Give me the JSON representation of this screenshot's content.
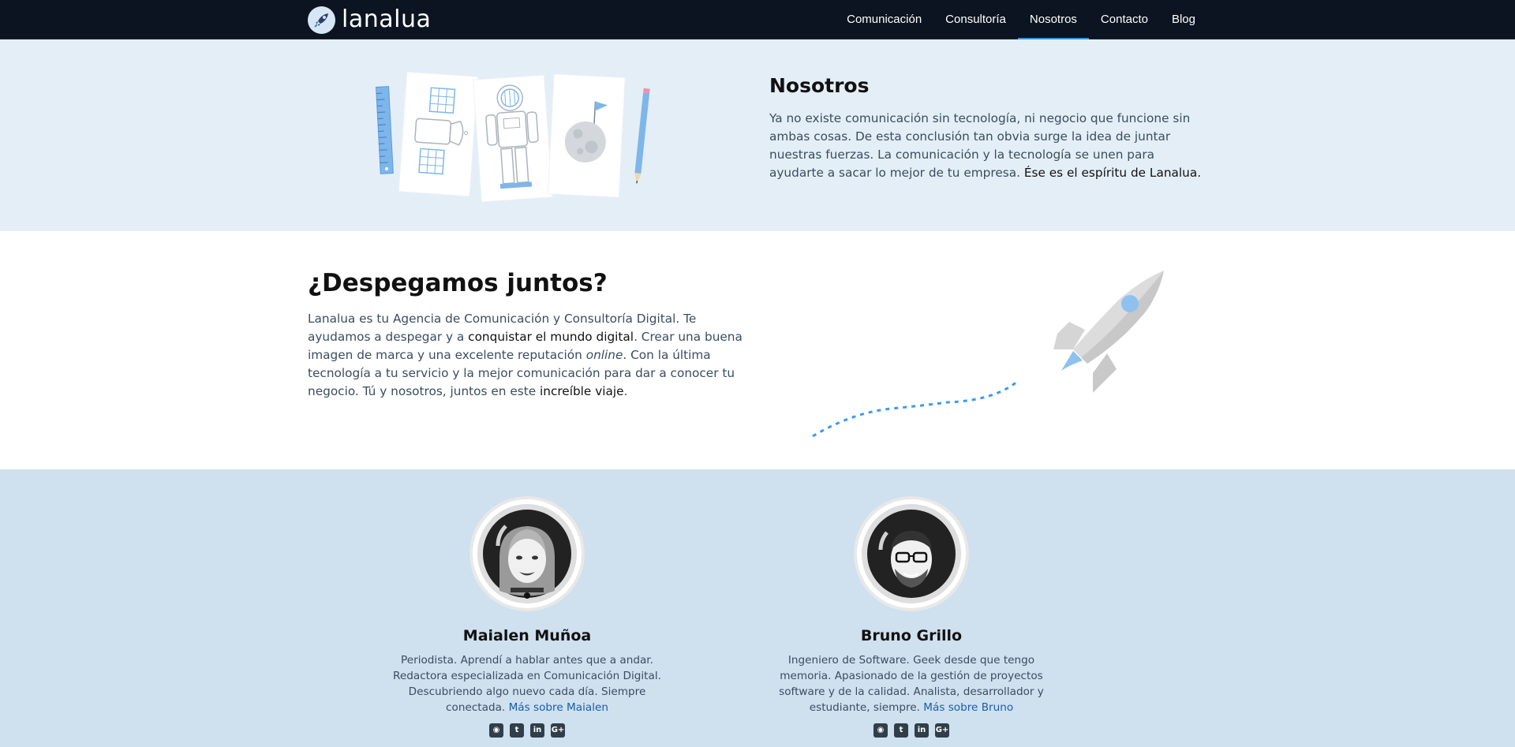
{
  "nav": {
    "logo_text": "lanalua",
    "items": [
      {
        "label": "Comunicación"
      },
      {
        "label": "Consultoría"
      },
      {
        "label": "Nosotros"
      },
      {
        "label": "Contacto"
      },
      {
        "label": "Blog"
      }
    ],
    "active": "Nosotros"
  },
  "about": {
    "title": "Nosotros",
    "text": "Ya no existe comunicación sin tecnología, ni negocio que funcione sin ambas cosas. De esta conclusión tan obvia surge la idea de juntar nuestras fuerzas. La comunicación y la tecnología se unen para ayudarte a sacar lo mejor de tu empresa.",
    "text_highlight": "Ése es el espíritu de Lanalua."
  },
  "launch": {
    "title": "¿Despegamos juntos?",
    "p1": "Lanalua es tu Agencia de Comunicación y Consultoría Digital. Te ayudamos a despegar y a",
    "hl1": "conquistar el mundo digital",
    "p2": ". Crear una buena imagen de marca y una excelente reputación",
    "em": "online",
    "p3": ". Con la última tecnología a tu servicio y la mejor comunicación para dar a conocer tu negocio. Tú y nosotros, juntos en este",
    "hl2": "increíble viaje",
    "p4": "."
  },
  "team": [
    {
      "name": "Maialen Muñoa",
      "bio": "Periodista. Aprendí a hablar antes que a andar. Redactora especializada en Comunicación Digital. Descubriendo algo nuevo cada día. Siempre conectada.",
      "link": "Más sobre Maialen"
    },
    {
      "name": "Bruno Grillo",
      "bio": "Ingeniero de Software. Geek desde que tengo memoria. Apasionado de la gestión de proyectos software y de la calidad. Analista, desarrollador y estudiante, siempre.",
      "link": "Más sobre Bruno"
    }
  ],
  "social_icons": [
    "rss-icon",
    "twitter-icon",
    "linkedin-icon",
    "google-plus-icon"
  ],
  "colors": {
    "nav_bg": "#0b1420",
    "active_underline": "#3b8fd9",
    "about_bg": "#e4eef7",
    "team_bg": "#cfe0ef",
    "link": "#1b5ea8",
    "accent_blue": "#8ec1f0"
  }
}
